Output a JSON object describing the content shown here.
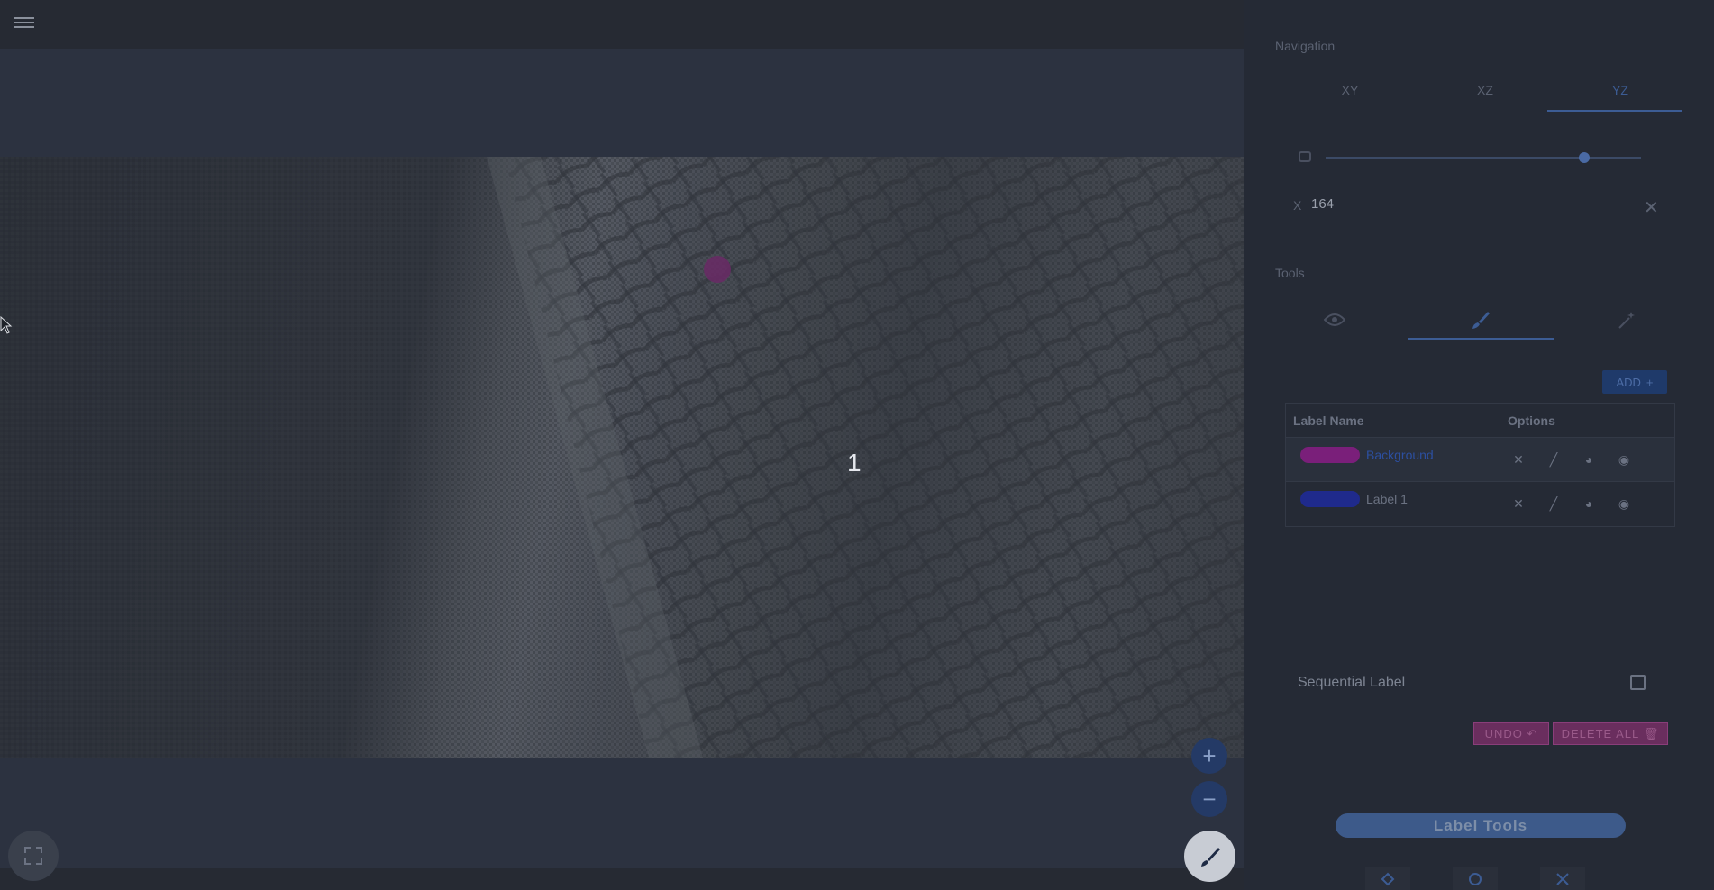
{
  "navigation": {
    "title": "Navigation",
    "tabs": [
      {
        "label": "XY"
      },
      {
        "label": "XZ"
      },
      {
        "label": "YZ"
      }
    ],
    "active_tab": "YZ",
    "slider_value_fraction": 0.82,
    "coord_axis": "X",
    "coord_value": "164"
  },
  "tools": {
    "title": "Tools",
    "icons": [
      "eye-icon",
      "brush-icon",
      "magic-wand-icon"
    ],
    "active": "brush-icon",
    "add_label": "ADD"
  },
  "label_table": {
    "headers": {
      "name": "Label Name",
      "options": "Options"
    },
    "rows": [
      {
        "name": "Background",
        "color": "#7a1f7a",
        "selected": true
      },
      {
        "name": "Label 1",
        "color": "#1f2a8c",
        "selected": false
      }
    ]
  },
  "sequential": {
    "label": "Sequential Label",
    "checked": false
  },
  "actions": {
    "undo": "UNDO",
    "delete_all": "DELETE ALL"
  },
  "label_tools_button": "Label Tools",
  "viewer": {
    "slice_number": "1"
  },
  "colors": {
    "accent": "#3c5c94",
    "danger": "#6a2e5e",
    "panel_bg": "#252a35"
  }
}
